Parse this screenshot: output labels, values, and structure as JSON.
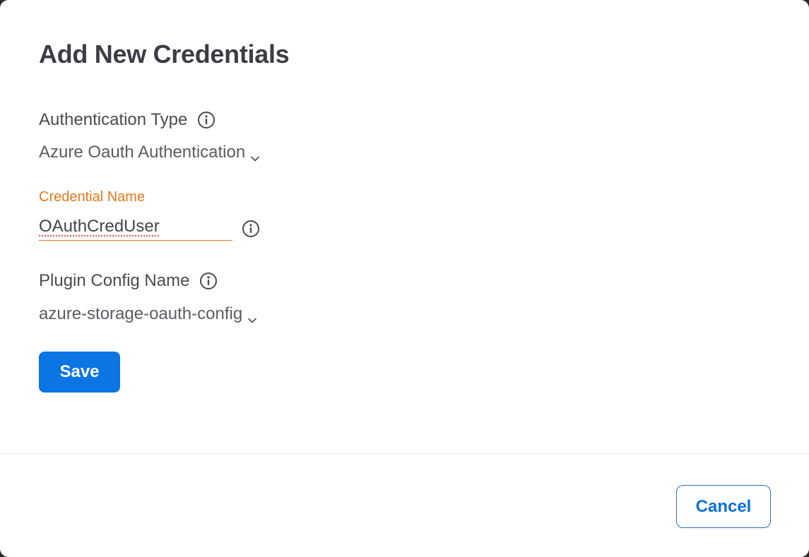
{
  "dialog": {
    "title": "Add New Credentials"
  },
  "auth_type": {
    "label": "Authentication Type",
    "info_icon": "info-circle-icon",
    "selected": "Azure Oauth Authentication",
    "dropdown_icon": "chevron-down-icon"
  },
  "credential_name": {
    "label": "Credential Name",
    "value": "OAuthCredUser",
    "info_icon": "info-circle-icon"
  },
  "plugin_config": {
    "label": "Plugin Config Name",
    "info_icon": "info-circle-icon",
    "selected": "azure-storage-oauth-config",
    "dropdown_icon": "chevron-down-icon"
  },
  "actions": {
    "save_label": "Save",
    "cancel_label": "Cancel"
  },
  "colors": {
    "primary": "#0a75e3",
    "focus_accent": "#e8771a",
    "title_text": "#3c3c46"
  }
}
